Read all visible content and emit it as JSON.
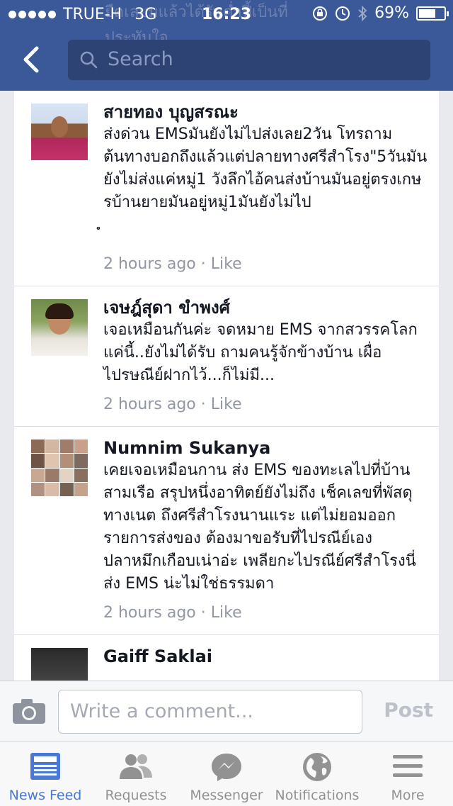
{
  "status_bar": {
    "carrier": "TRUE-H",
    "network": "3G",
    "time": "16:23",
    "battery": "69%",
    "battery_level": 0.69
  },
  "header_ghost": [
    "ยืดเลยมแล้วได้รับค่ำปี้เป็นที่",
    "ประทับใจ"
  ],
  "search": {
    "placeholder": "Search"
  },
  "comments": [
    {
      "name": "สายทอง บุญสรณะ",
      "text": "ส่งด่วน EMSมันยังไม่ไปส่งเลย2วัน โทรถามต้นทางบอกถึงแล้วแต่ปลายทางศรีสำโรง\"5วันมันยังไม่ส่งแค่หมู่1 วังลึกไอ้คนส่งบ้านมันอยู่ตรงเกษรบ้านยายมันอยู่หมู่1มันยังไม่ไป",
      "extra": "ໍ",
      "time": "2 hours ago",
      "like": "Like"
    },
    {
      "name": "เจษฎ์สุดา ขำพงศ์",
      "text": "เจอเหมือนกันค่ะ  จดหมาย EMS  จากสวรรคโลกแค่นี้..ยังไม่ได้รับ  ถามคนรู้จักข้างบ้าน  เผื่อไปรษณีย์ฝากไว้...ก็ไม่มี...",
      "time": "2 hours ago",
      "like": "Like"
    },
    {
      "name": "Numnim Sukanya",
      "text": "เคยเจอเหมือนกาน ส่ง EMS ของทะเลไปที่บ้านสามเรือ สรุปหนึ่งอาทิตย์ยังไม่ถึง เช็คเลขที่พัสดุทางเนต ถึงศรีสำโรงนานแระ แต่ไม่ยอมออกรายการส่งของ ต้องมาขอรับที่ไปรณีย์เอง ปลาหมึกเกือบเน่าอ่ะ เพลียกะไปรณีย์ศรีสำโรงนี่ส่ง EMS น่ะไม่ใช่ธรรมดา",
      "time": "2 hours ago",
      "like": "Like"
    },
    {
      "name": "Gaiff Saklai"
    }
  ],
  "comment_bar": {
    "placeholder": "Write a comment...",
    "post_label": "Post"
  },
  "tabs": [
    {
      "label": "News Feed",
      "icon": "news-feed-icon",
      "active": true
    },
    {
      "label": "Requests",
      "icon": "friends-icon"
    },
    {
      "label": "Messenger",
      "icon": "messenger-icon"
    },
    {
      "label": "Notifications",
      "icon": "globe-icon"
    },
    {
      "label": "More",
      "icon": "menu-icon"
    }
  ],
  "colors": {
    "header": "#3b5998",
    "active_tab": "#4a78d6",
    "meta": "#9197a3"
  }
}
